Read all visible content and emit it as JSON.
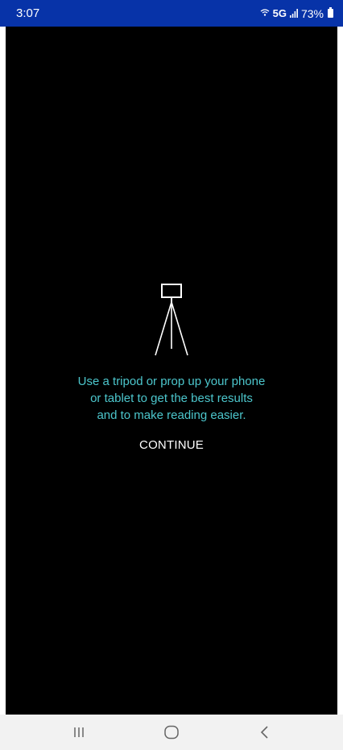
{
  "status_bar": {
    "time": "3:07",
    "network": "5G",
    "battery": "73%",
    "colors": {
      "background": "#0733a8",
      "text": "#ffffff"
    }
  },
  "main": {
    "icon": "tripod-icon",
    "instruction": "Use a tripod or prop up your phone\nor tablet to get the best results\nand to make reading easier.",
    "continue_label": "CONTINUE",
    "colors": {
      "background": "#000000",
      "instruction_text": "#4cc6cc",
      "button_text": "#ffffff"
    }
  },
  "nav_bar": {
    "icons": [
      "recents-icon",
      "home-icon",
      "back-icon"
    ]
  }
}
